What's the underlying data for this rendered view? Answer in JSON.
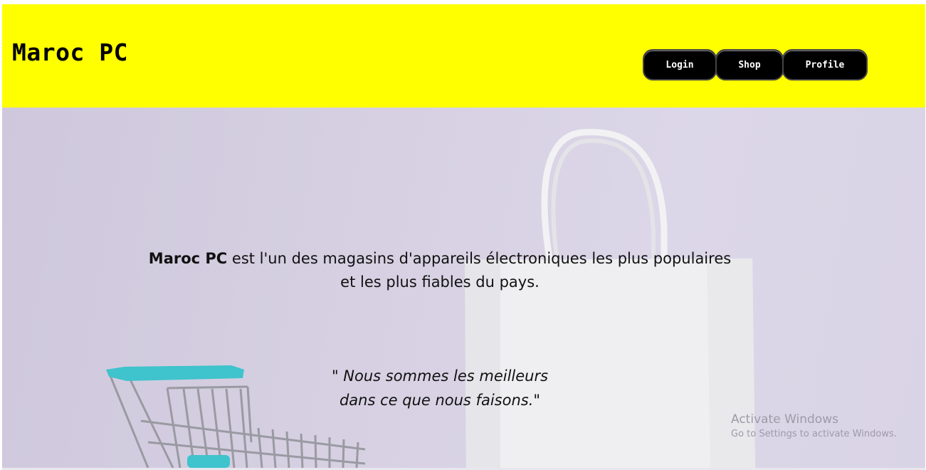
{
  "header": {
    "brand": "Maroc PC",
    "nav": {
      "login": "Login",
      "shop": "Shop",
      "profile": "Profile"
    }
  },
  "hero": {
    "tagline_brand": "Maroc PC",
    "tagline_rest": " est l'un des magasins d'appareils électroniques les plus populaires et les plus fiables du pays.",
    "quote_line1": "\" Nous sommes les meilleurs",
    "quote_line2": "dans ce que nous faisons.\""
  },
  "watermark": {
    "title": "Activate Windows",
    "subtitle": "Go to Settings to activate Windows."
  },
  "colors": {
    "header_bg": "#ffff00",
    "button_bg": "#000000",
    "hero_bg": "#d6d0e2",
    "cart_handle": "#3fc3cc"
  },
  "icons": [
    "shopping-bag-image",
    "shopping-cart-image"
  ]
}
